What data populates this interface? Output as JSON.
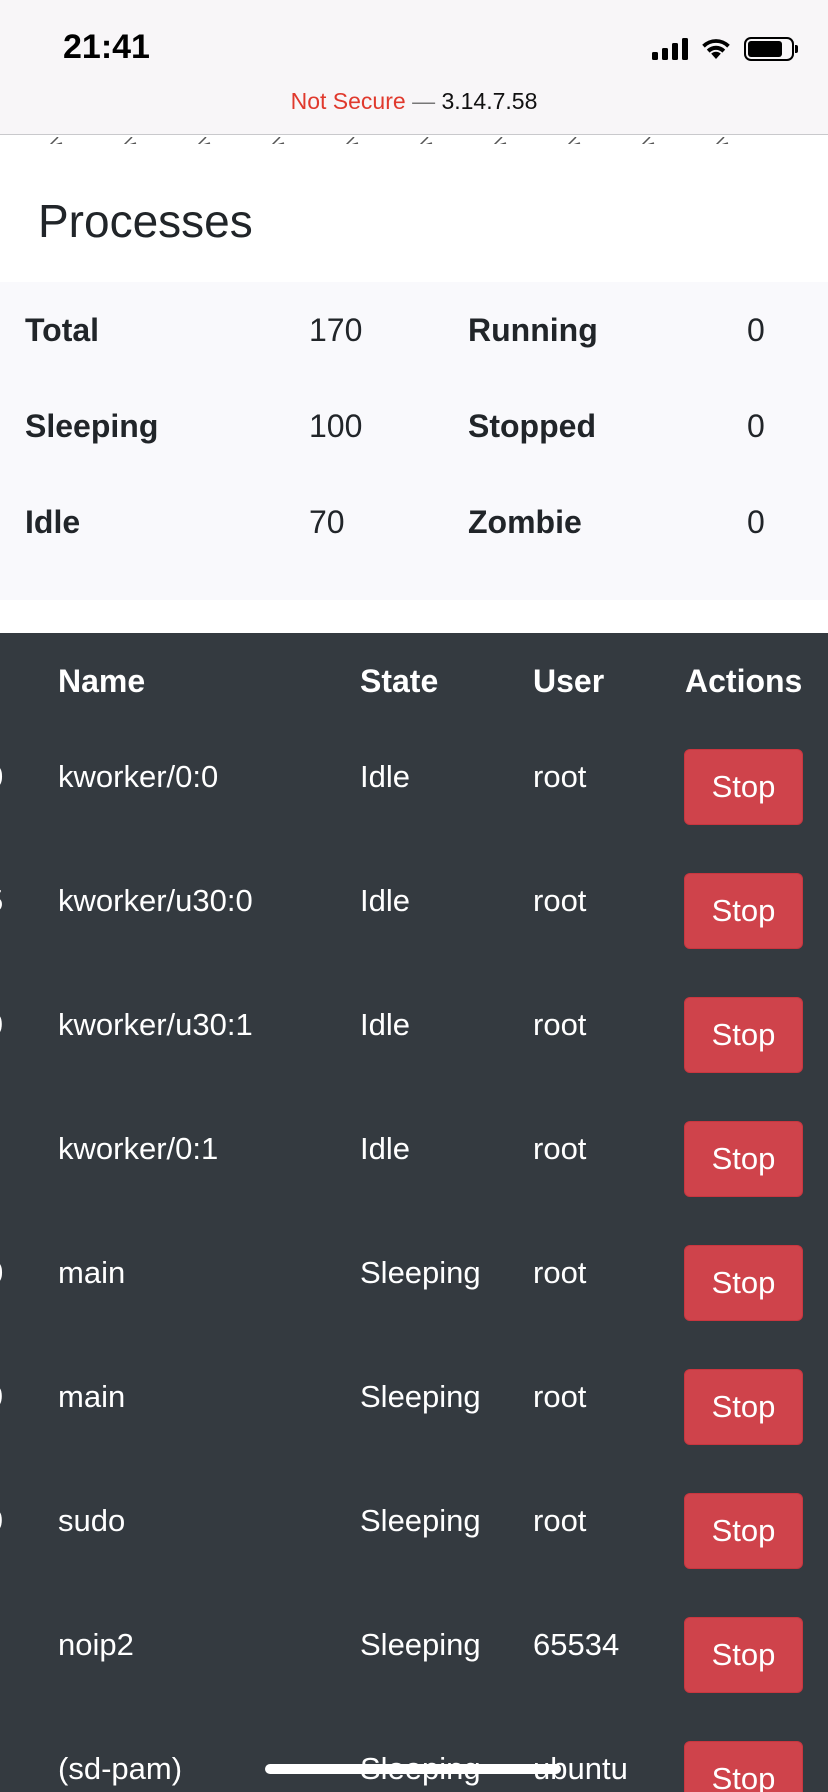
{
  "status_bar": {
    "time": "21:41",
    "icons": [
      "cellular-signal-icon",
      "wifi-icon",
      "battery-icon"
    ]
  },
  "url_bar": {
    "security_label": "Not Secure",
    "separator": "—",
    "host": "3.14.7.58"
  },
  "processes": {
    "title": "Processes",
    "summary": [
      {
        "label": "Total",
        "value": "170",
        "label2": "Running",
        "value2": "0"
      },
      {
        "label": "Sleeping",
        "value": "100",
        "label2": "Stopped",
        "value2": "0"
      },
      {
        "label": "Idle",
        "value": "70",
        "label2": "Zombie",
        "value2": "0"
      }
    ]
  },
  "table": {
    "headers": [
      "Name",
      "State",
      "User",
      "Actions"
    ],
    "rows": [
      {
        "pid_fragment": "0",
        "name": "kworker/0:0",
        "state": "Idle",
        "user": "root",
        "action": "Stop"
      },
      {
        "pid_fragment": "5",
        "name": "kworker/u30:0",
        "state": "Idle",
        "user": "root",
        "action": "Stop"
      },
      {
        "pid_fragment": "9",
        "name": "kworker/u30:1",
        "state": "Idle",
        "user": "root",
        "action": "Stop"
      },
      {
        "pid_fragment": "",
        "name": "kworker/0:1",
        "state": "Idle",
        "user": "root",
        "action": "Stop"
      },
      {
        "pid_fragment": "0",
        "name": "main",
        "state": "Sleeping",
        "user": "root",
        "action": "Stop"
      },
      {
        "pid_fragment": "9",
        "name": "main",
        "state": "Sleeping",
        "user": "root",
        "action": "Stop"
      },
      {
        "pid_fragment": "9",
        "name": "sudo",
        "state": "Sleeping",
        "user": "root",
        "action": "Stop"
      },
      {
        "pid_fragment": "",
        "name": "noip2",
        "state": "Sleeping",
        "user": "65534",
        "action": "Stop"
      },
      {
        "pid_fragment": "",
        "name": "(sd-pam)",
        "state": "Sleeping",
        "user": "ubuntu",
        "action": "Stop"
      }
    ]
  },
  "colors": {
    "table_bg": "#343a40",
    "stop_button": "#cf434b",
    "warning_text": "#e0392d",
    "summary_bg": "#f9f9fc"
  }
}
